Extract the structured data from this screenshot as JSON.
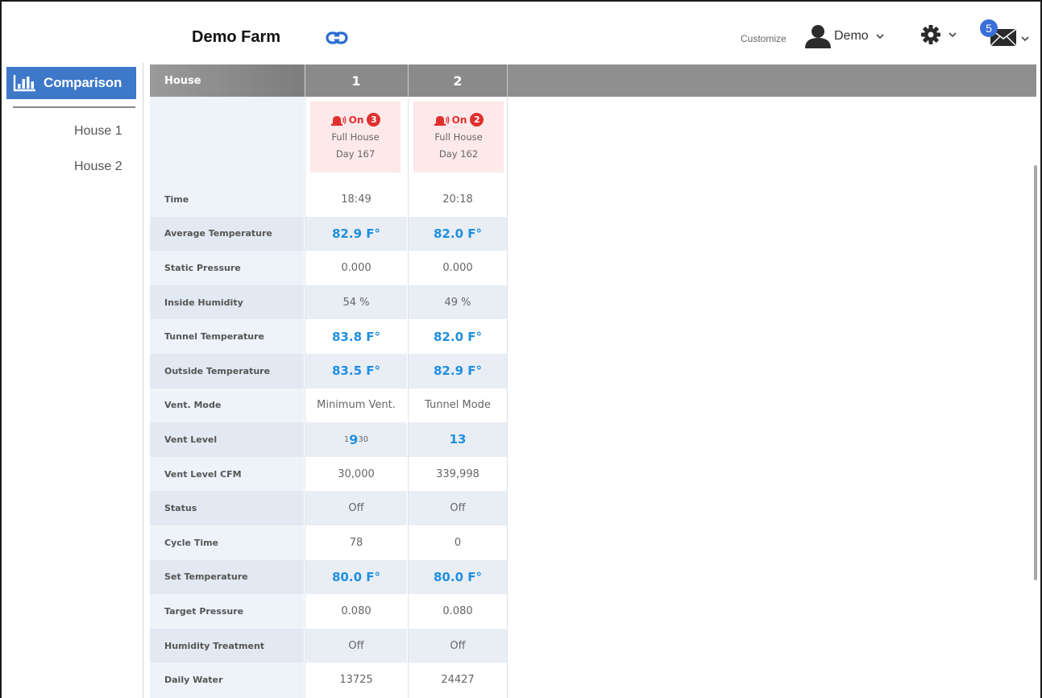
{
  "header": {
    "farm_name": "Demo Farm",
    "customize": "Customize",
    "user_name": "Demo",
    "mail_count": "5"
  },
  "sidebar": {
    "active": "Comparison",
    "items": [
      {
        "label": "House 1"
      },
      {
        "label": "House 2"
      }
    ]
  },
  "table": {
    "header_label": "House",
    "houses": [
      {
        "number": "1",
        "alarm": "On",
        "alarm_count": "3",
        "mode": "Full House",
        "day": "Day 167"
      },
      {
        "number": "2",
        "alarm": "On",
        "alarm_count": "2",
        "mode": "Full House",
        "day": "Day 162"
      }
    ],
    "rows": [
      {
        "label": "Time",
        "values": [
          "18:49",
          "20:18"
        ],
        "highlight": false
      },
      {
        "label": "Average Temperature",
        "values": [
          "82.9 F°",
          "82.0 F°"
        ],
        "highlight": true
      },
      {
        "label": "Static Pressure",
        "values": [
          "0.000",
          "0.000"
        ],
        "highlight": false
      },
      {
        "label": "Inside Humidity",
        "values": [
          "54 %",
          "49 %"
        ],
        "highlight": false
      },
      {
        "label": "Tunnel Temperature",
        "values": [
          "83.8 F°",
          "82.0 F°"
        ],
        "highlight": true
      },
      {
        "label": "Outside Temperature",
        "values": [
          "83.5 F°",
          "82.9 F°"
        ],
        "highlight": true
      },
      {
        "label": "Vent. Mode",
        "values": [
          "Minimum Vent.",
          "Tunnel Mode"
        ],
        "highlight": false
      },
      {
        "label": "Vent Level",
        "values": [
          "",
          "13"
        ],
        "highlight": true
      },
      {
        "label": "Vent Level CFM",
        "values": [
          "30,000",
          "339,998"
        ],
        "highlight": false
      },
      {
        "label": "Status",
        "values": [
          "Off",
          "Off"
        ],
        "highlight": false
      },
      {
        "label": "Cycle Time",
        "values": [
          "78",
          "0"
        ],
        "highlight": false
      },
      {
        "label": "Set Temperature",
        "values": [
          "80.0 F°",
          "80.0 F°"
        ],
        "highlight": true
      },
      {
        "label": "Target Pressure",
        "values": [
          "0.080",
          "0.080"
        ],
        "highlight": false
      },
      {
        "label": "Humidity Treatment",
        "values": [
          "Off",
          "Off"
        ],
        "highlight": false
      },
      {
        "label": "Daily Water",
        "values": [
          "13725",
          "24427"
        ],
        "highlight": false
      }
    ],
    "vent_level_house1": {
      "pre": "1",
      "main": "9",
      "post": "30"
    }
  },
  "colors": {
    "accent": "#3d78c9",
    "value_blue": "#1f8fe0",
    "alarm_red": "#e0302e",
    "header_gray": "#8f8f8f"
  }
}
